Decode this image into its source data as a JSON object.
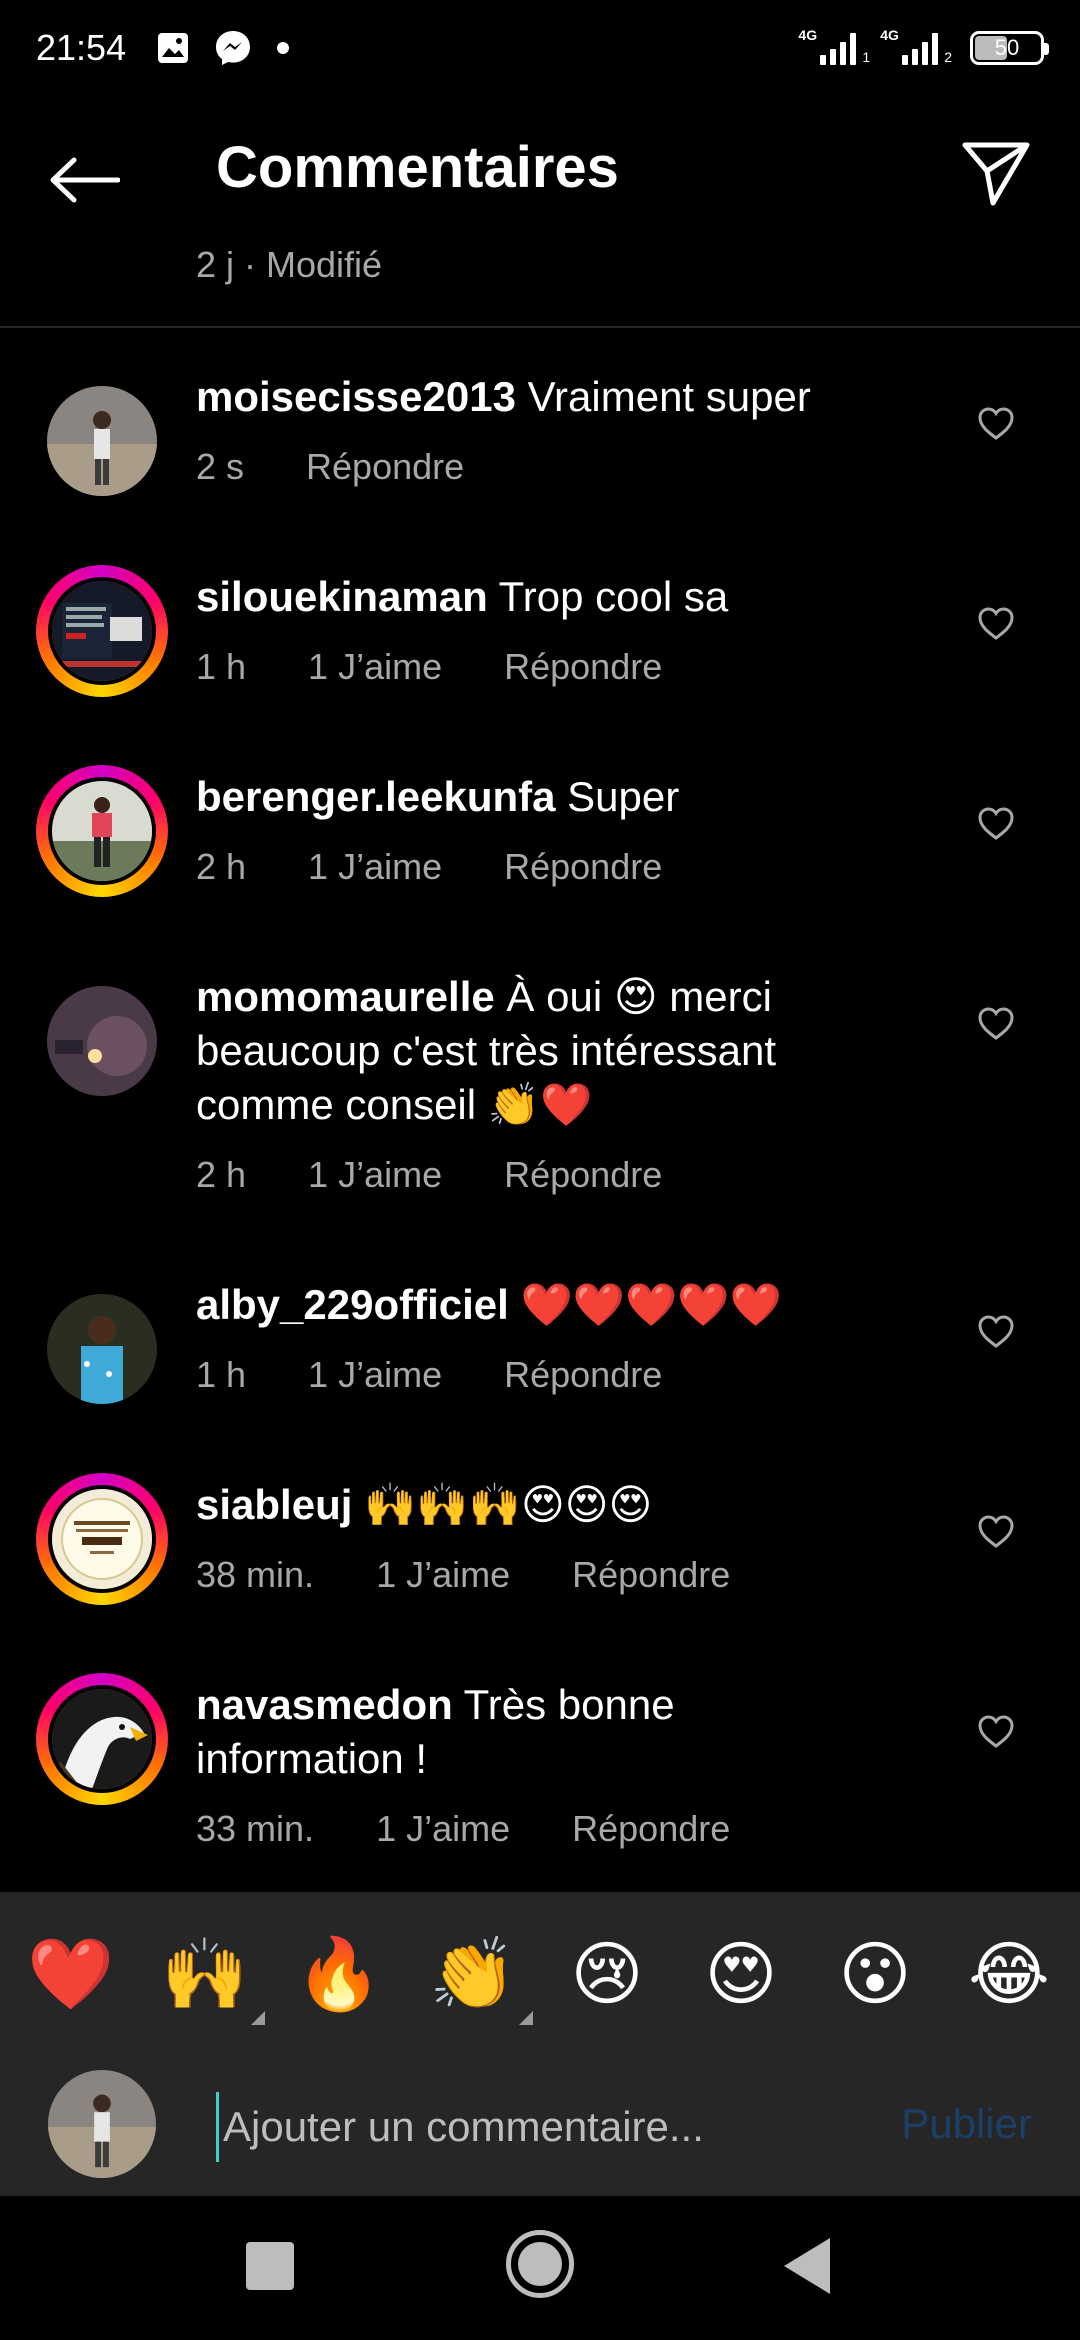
{
  "status_bar": {
    "time": "21:54",
    "network_1": "4G",
    "network_2": "4G",
    "sim_2_index": "1",
    "sim_3_index": "2",
    "battery": "50",
    "battery_level": 0.5,
    "icons": [
      "image-icon",
      "messenger-icon",
      "dot-icon"
    ]
  },
  "header": {
    "title": "Commentaires",
    "post_meta": "2 j · Modifié"
  },
  "comments": [
    {
      "user": "moisecisse2013",
      "text": " Vraiment super",
      "time": "2 s",
      "likes": "",
      "reply": "Répondre"
    },
    {
      "user": "silouekinaman",
      "text": " Trop cool sa",
      "time": "1 h",
      "likes": "1 J’aime",
      "reply": "Répondre"
    },
    {
      "user": "berenger.leekunfa",
      "text": " Super",
      "time": "2 h",
      "likes": "1 J’aime",
      "reply": "Répondre"
    },
    {
      "user": "momomaurelle",
      "text": " À oui 😍 merci beaucoup c'est très intéressant comme conseil 👏❤️",
      "time": "2 h",
      "likes": "1 J’aime",
      "reply": "Répondre"
    },
    {
      "user": "alby_229officiel",
      "text": " ❤️❤️❤️❤️❤️",
      "time": "1 h",
      "likes": "1 J’aime",
      "reply": "Répondre"
    },
    {
      "user": "siableuj",
      "text": " 🙌🙌🙌😍😍😍",
      "time": "38 min.",
      "likes": "1 J’aime",
      "reply": "Répondre"
    },
    {
      "user": "navasmedon",
      "text": " Très bonne information !",
      "time": "33 min.",
      "likes": "1 J’aime",
      "reply": "Répondre"
    }
  ],
  "emoji_bar": [
    "❤️",
    "🙌",
    "🔥",
    "👏",
    "😢",
    "😍",
    "😮",
    "😂"
  ],
  "composer": {
    "placeholder": "Ajouter un commentaire...",
    "publish": "Publier"
  },
  "colors": {
    "background": "#000000",
    "secondary_text": "#a8a8a8",
    "panel": "#262626",
    "publish_disabled": "#1b3f66",
    "cursor": "#43d0c4"
  }
}
